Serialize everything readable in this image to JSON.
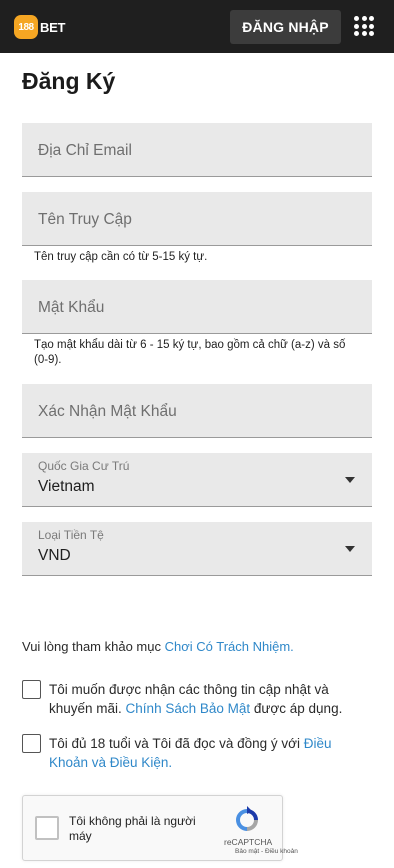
{
  "header": {
    "logo_number": "188",
    "logo_text": "BET",
    "login_button": "ĐĂNG NHẬP",
    "menu_icon": "grid-icon"
  },
  "page": {
    "title": "Đăng Ký"
  },
  "form": {
    "email": {
      "placeholder": "Địa Chỉ Email"
    },
    "username": {
      "placeholder": "Tên Truy Cập",
      "hint": "Tên truy cập cần có từ 5-15 ký tự."
    },
    "password": {
      "placeholder": "Mật Khẩu",
      "hint": "Tạo mật khẩu dài từ 6 - 15 ký tự, bao gồm cả chữ (a-z) và số (0-9)."
    },
    "confirm_password": {
      "placeholder": "Xác Nhận Mật Khẩu"
    },
    "country": {
      "label": "Quốc Gia Cư Trú",
      "value": "Vietnam"
    },
    "currency": {
      "label": "Loại Tiền Tệ",
      "value": "VND"
    }
  },
  "responsible": {
    "text": "Vui lòng tham khảo mục ",
    "link": "Chơi Có Trách Nhiệm."
  },
  "consent": {
    "marketing": {
      "text": "Tôi muốn được nhận các thông tin cập nhật và khuyến mãi. ",
      "link": "Chính Sách Bảo Mật",
      "suffix": " được áp dụng."
    },
    "terms": {
      "text": "Tôi đủ 18 tuổi và Tôi đã đọc và đồng ý với ",
      "link": "Điều Khoản và Điều Kiện."
    }
  },
  "captcha": {
    "label": "Tôi không phải là người máy",
    "brand": "reCAPTCHA",
    "links": "Bảo mật - Điều khoản"
  },
  "colors": {
    "header_bg": "#1f1f1f",
    "brand": "#f5a623",
    "link": "#2f88c9",
    "field_bg": "#e9e9e9"
  }
}
